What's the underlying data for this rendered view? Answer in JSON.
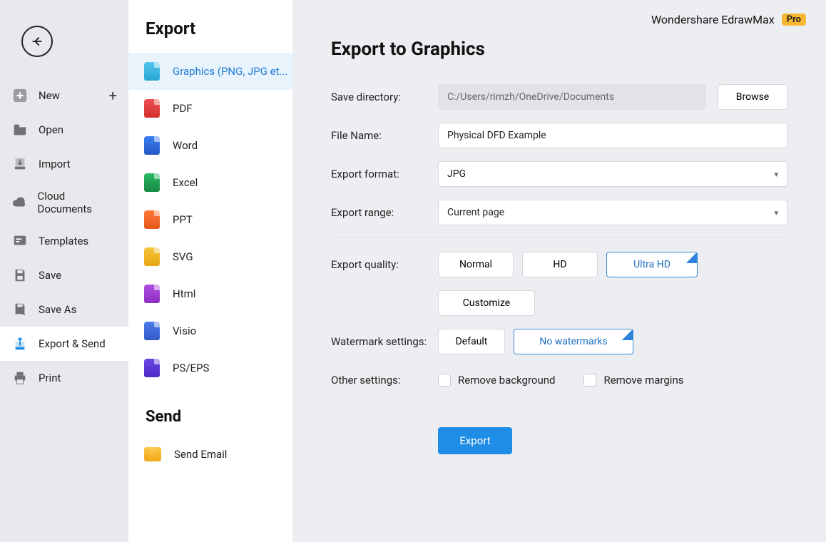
{
  "app": {
    "title": "Wondershare EdrawMax",
    "badge": "Pro"
  },
  "sidebar": {
    "items": [
      {
        "label": "New"
      },
      {
        "label": "Open"
      },
      {
        "label": "Import"
      },
      {
        "label": "Cloud Documents"
      },
      {
        "label": "Templates"
      },
      {
        "label": "Save"
      },
      {
        "label": "Save As"
      },
      {
        "label": "Export & Send"
      },
      {
        "label": "Print"
      }
    ]
  },
  "export_panel": {
    "title": "Export",
    "items": [
      {
        "label": "Graphics (PNG, JPG et..."
      },
      {
        "label": "PDF"
      },
      {
        "label": "Word"
      },
      {
        "label": "Excel"
      },
      {
        "label": "PPT"
      },
      {
        "label": "SVG"
      },
      {
        "label": "Html"
      },
      {
        "label": "Visio"
      },
      {
        "label": "PS/EPS"
      }
    ],
    "send_title": "Send",
    "send_items": [
      {
        "label": "Send Email"
      }
    ]
  },
  "form": {
    "heading": "Export to Graphics",
    "save_directory_label": "Save directory:",
    "save_directory_value": "C:/Users/rimzh/OneDrive/Documents",
    "browse_label": "Browse",
    "file_name_label": "File Name:",
    "file_name_value": "Physical DFD Example",
    "export_format_label": "Export format:",
    "export_format_value": "JPG",
    "export_range_label": "Export range:",
    "export_range_value": "Current page",
    "export_quality_label": "Export quality:",
    "quality_options": {
      "normal": "Normal",
      "hd": "HD",
      "ultra": "Ultra HD",
      "customize": "Customize"
    },
    "watermark_label": "Watermark settings:",
    "watermark_options": {
      "default": "Default",
      "none": "No watermarks"
    },
    "other_label": "Other settings:",
    "remove_bg": "Remove background",
    "remove_margins": "Remove margins",
    "export_btn": "Export"
  }
}
